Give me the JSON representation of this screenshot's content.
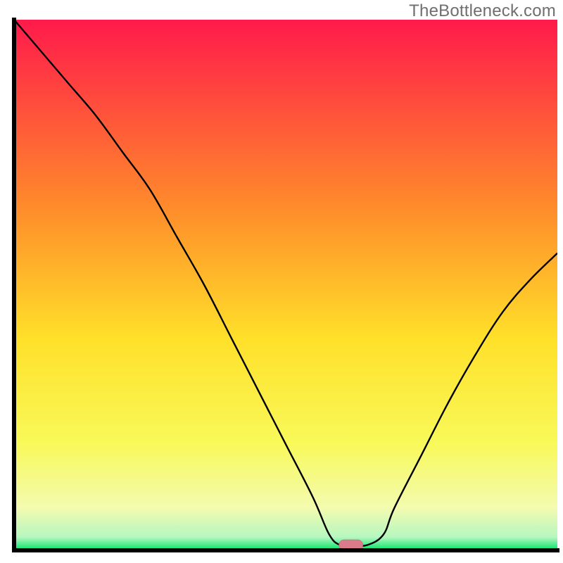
{
  "watermark": "TheBottleneck.com",
  "chart_data": {
    "type": "line",
    "title": "",
    "xlabel": "",
    "ylabel": "",
    "xlim": [
      0,
      100
    ],
    "ylim": [
      0,
      100
    ],
    "grid": false,
    "legend": false,
    "series": [
      {
        "name": "bottleneck-curve",
        "x": [
          0,
          5,
          10,
          15,
          20,
          25,
          30,
          35,
          40,
          45,
          50,
          55,
          58,
          60,
          62,
          65,
          68,
          70,
          75,
          80,
          85,
          90,
          95,
          100
        ],
        "values": [
          100,
          94,
          88,
          82,
          75,
          68,
          59,
          50,
          40,
          30,
          20,
          10,
          3,
          1,
          1,
          1,
          3,
          8,
          18,
          28,
          37,
          45,
          51,
          56
        ]
      }
    ],
    "marker": {
      "name": "optimal-point",
      "x": 62,
      "y": 1,
      "color": "#d97b8a"
    },
    "background_gradient": {
      "top": "#ff1a4b",
      "mid_upper": "#ff9a2b",
      "mid": "#ffe029",
      "mid_lower": "#f8f98a",
      "green": "#00e567"
    },
    "axis_color": "#000000",
    "line_color": "#000000"
  }
}
